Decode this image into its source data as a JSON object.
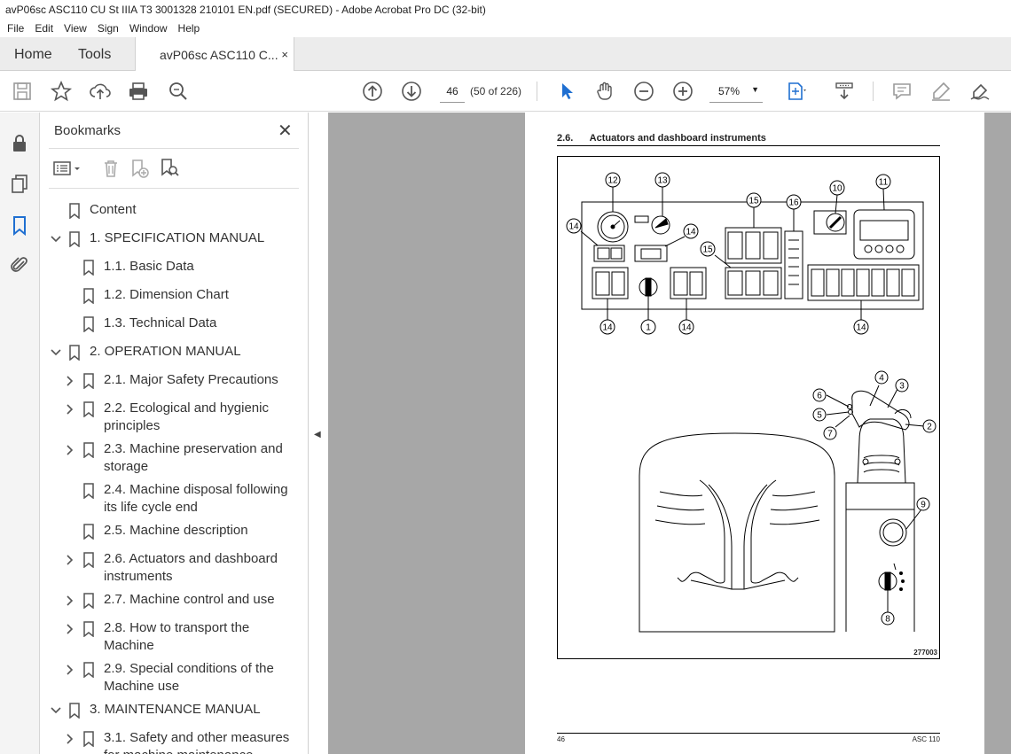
{
  "window": {
    "title": "avP06sc ASC110 CU St IIIA T3 3001328 210101 EN.pdf (SECURED) - Adobe Acrobat Pro DC (32-bit)"
  },
  "menu": [
    "File",
    "Edit",
    "View",
    "Sign",
    "Window",
    "Help"
  ],
  "tabs": {
    "home": "Home",
    "tools": "Tools",
    "doc": "avP06sc ASC110 C...",
    "close": "×"
  },
  "toolbar": {
    "page_current": "46",
    "page_count": "(50 of 226)",
    "zoom": "57%",
    "icons": [
      "save-icon",
      "star-icon",
      "upload-icon",
      "print-icon",
      "search-icon",
      "page-up-icon",
      "page-down-icon",
      "pointer-icon",
      "hand-icon",
      "zoom-out-icon",
      "zoom-in-icon",
      "zoom-dropdown-icon",
      "fit-icon",
      "scroll-mode-icon",
      "comment-icon",
      "highlight-icon",
      "sign-icon"
    ]
  },
  "bookmarks_panel": {
    "title": "Bookmarks",
    "close": "✕",
    "items": [
      {
        "label": "Content",
        "level": 0,
        "expander": "none"
      },
      {
        "label": "1. SPECIFICATION MANUAL",
        "level": 0,
        "expander": "open"
      },
      {
        "label": "1.1. Basic Data",
        "level": 1,
        "expander": "none"
      },
      {
        "label": "1.2. Dimension Chart",
        "level": 1,
        "expander": "none"
      },
      {
        "label": "1.3. Technical Data",
        "level": 1,
        "expander": "none"
      },
      {
        "label": "2. OPERATION MANUAL",
        "level": 0,
        "expander": "open"
      },
      {
        "label": "2.1. Major Safety Precautions",
        "level": 1,
        "expander": "closed"
      },
      {
        "label": "2.2. Ecological and hygienic",
        "label2": "principles",
        "level": 1,
        "expander": "closed"
      },
      {
        "label": "2.3. Machine preservation and",
        "label2": "storage",
        "level": 1,
        "expander": "closed"
      },
      {
        "label": "2.4. Machine disposal following",
        "label2": "its life cycle end",
        "level": 1,
        "expander": "none"
      },
      {
        "label": "2.5. Machine description",
        "level": 1,
        "expander": "none"
      },
      {
        "label": "2.6. Actuators and dashboard",
        "label2": "instruments",
        "level": 1,
        "expander": "closed"
      },
      {
        "label": "2.7. Machine control and use",
        "level": 1,
        "expander": "closed"
      },
      {
        "label": "2.8. How to transport the",
        "label2": "Machine",
        "level": 1,
        "expander": "closed"
      },
      {
        "label": "2.9. Special conditions of the",
        "label2": "Machine use",
        "level": 1,
        "expander": "closed"
      },
      {
        "label": "3. MAINTENANCE MANUAL",
        "level": 0,
        "expander": "open"
      },
      {
        "label": "3.1. Safety and other measures",
        "label2": "for machine maintenance",
        "level": 1,
        "expander": "closed"
      }
    ]
  },
  "document": {
    "section_number": "2.6.",
    "section_title": "Actuators and dashboard instruments",
    "figure_code": "277003",
    "callouts": [
      "1",
      "2",
      "3",
      "4",
      "5",
      "6",
      "7",
      "8",
      "9",
      "10",
      "11",
      "12",
      "13",
      "14",
      "15",
      "16"
    ],
    "page_number": "46",
    "footer_model": "ASC 110"
  }
}
